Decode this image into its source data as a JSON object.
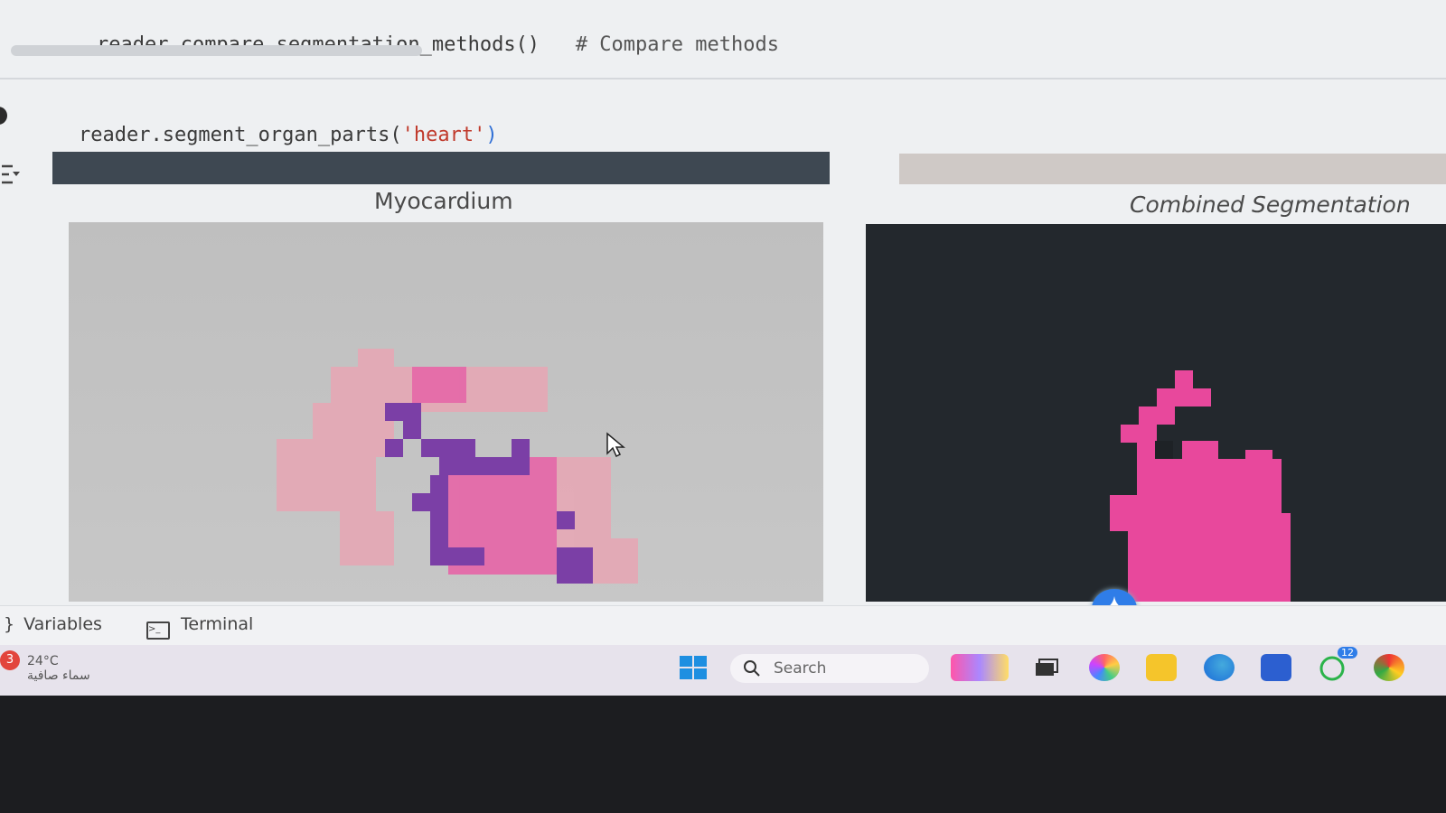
{
  "editor": {
    "line_top_code": "reader.compare_segmentation_methods()",
    "line_top_comment": "# Compare methods",
    "cell_code_prefix": "reader.segment_organ_parts(",
    "cell_code_arg": "'heart'",
    "cell_code_suffix": ")"
  },
  "output": {
    "left_title": "Myocardium",
    "right_title": "Combined Segmentation"
  },
  "statusbar": {
    "variables_label": "Variables",
    "terminal_label": "Terminal"
  },
  "taskbar": {
    "weather_temp": "24°C",
    "weather_desc": "سماء صافية",
    "notification_count": "3",
    "search_placeholder": "Search",
    "whatsapp_badge": "12"
  },
  "colors": {
    "accent_blue": "#2f7de8",
    "segmentation_pink": "#e8489c",
    "segmentation_purple": "#7b3fa6"
  }
}
